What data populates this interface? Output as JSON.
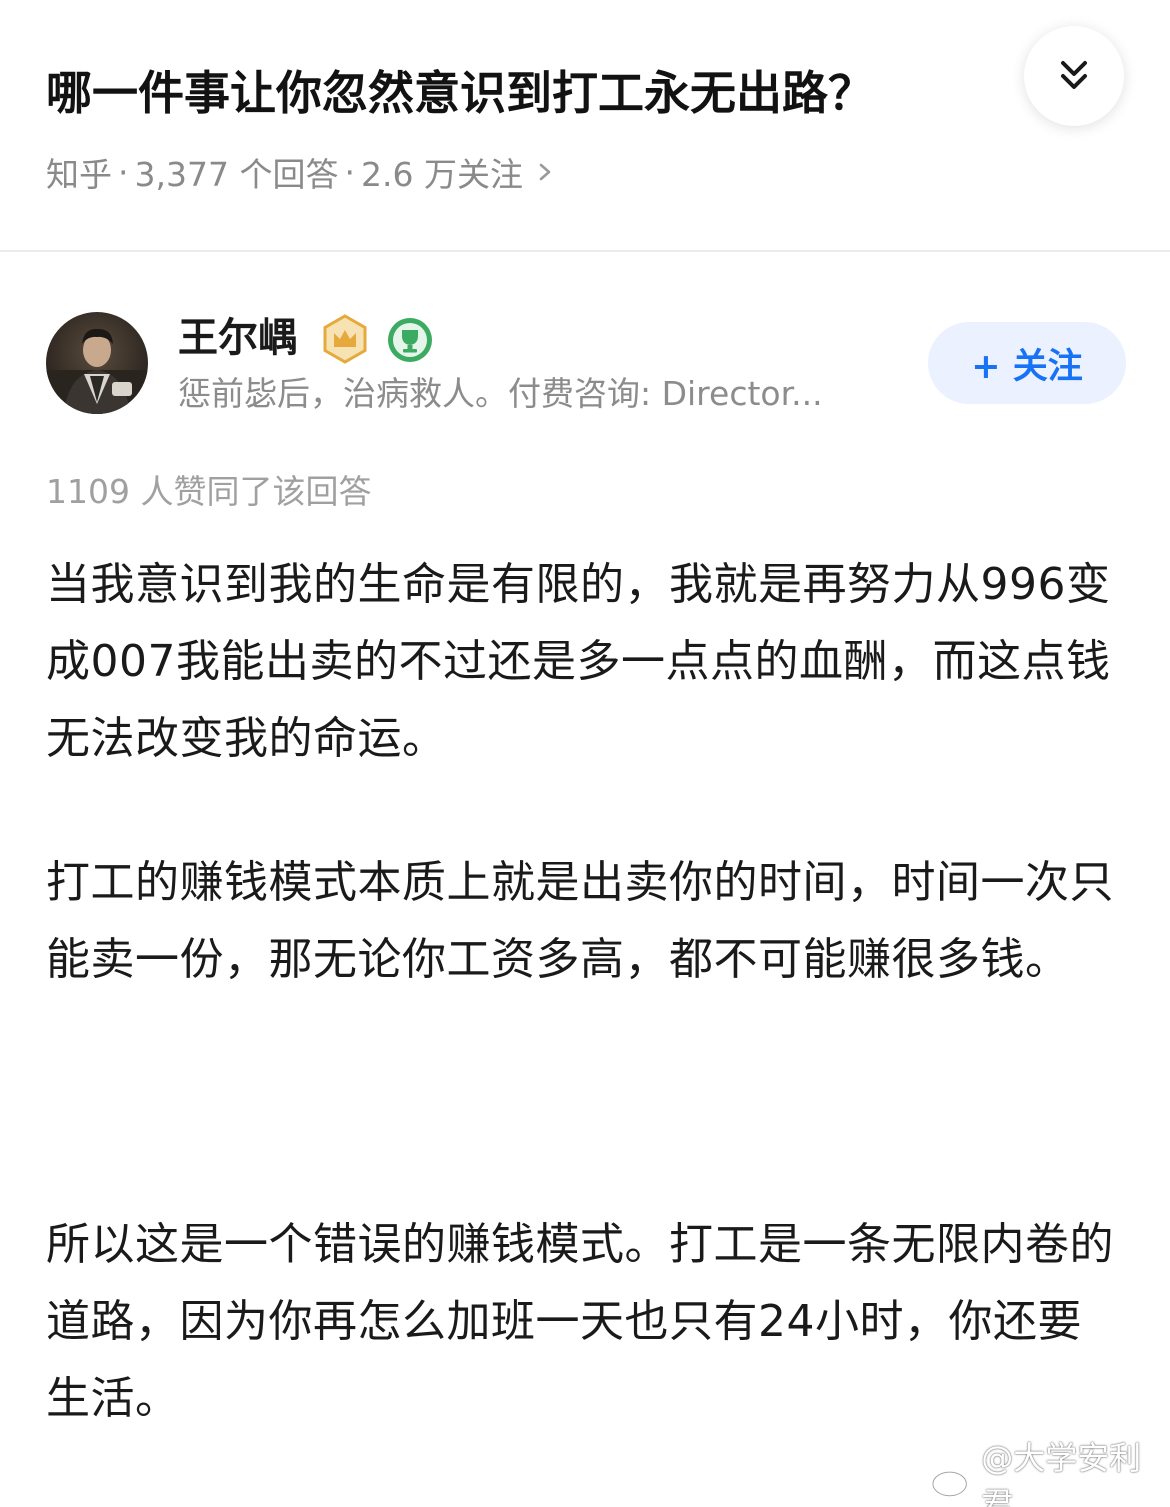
{
  "question": {
    "title": "哪一件事让你忽然意识到打工永无出路？",
    "source": "知乎",
    "answers": "3,377 个回答",
    "followers": "2.6 万关注",
    "separator": "·"
  },
  "icons": {
    "collapse": "double-chevron-down-icon",
    "meta_arrow": "chevron-right-icon",
    "crown_badge": "crown-badge-icon",
    "trophy_badge": "trophy-badge-icon"
  },
  "author": {
    "name": "王尔嵎",
    "bio": "惩前毖后，治病救人。付费咨询: Director...",
    "follow_label": "+ 关注"
  },
  "answer": {
    "upvote_text": "1109 人赞同了该回答",
    "paragraphs": [
      "当我意识到我的生命是有限的，我就是再努力从996变成007我能出卖的不过还是多一点点的血酬，而这点钱无法改变我的命运。",
      "打工的赚钱模式本质上就是出卖你的时间，时间一次只能卖一份，那无论你工资多高，都不可能赚很多钱。",
      "所以这是一个错误的赚钱模式。打工是一条无限内卷的道路，因为你再怎么加班一天也只有24小时，你还要生活。"
    ]
  },
  "watermark": {
    "text": "@大学安利君",
    "icon": "weibo-icon"
  },
  "colors": {
    "accent": "#1772f6",
    "follow_bg": "#ebf1ff",
    "meta_gray": "#8a8a8a",
    "crown_gold": "#e6a93b",
    "trophy_green": "#3cab62"
  }
}
